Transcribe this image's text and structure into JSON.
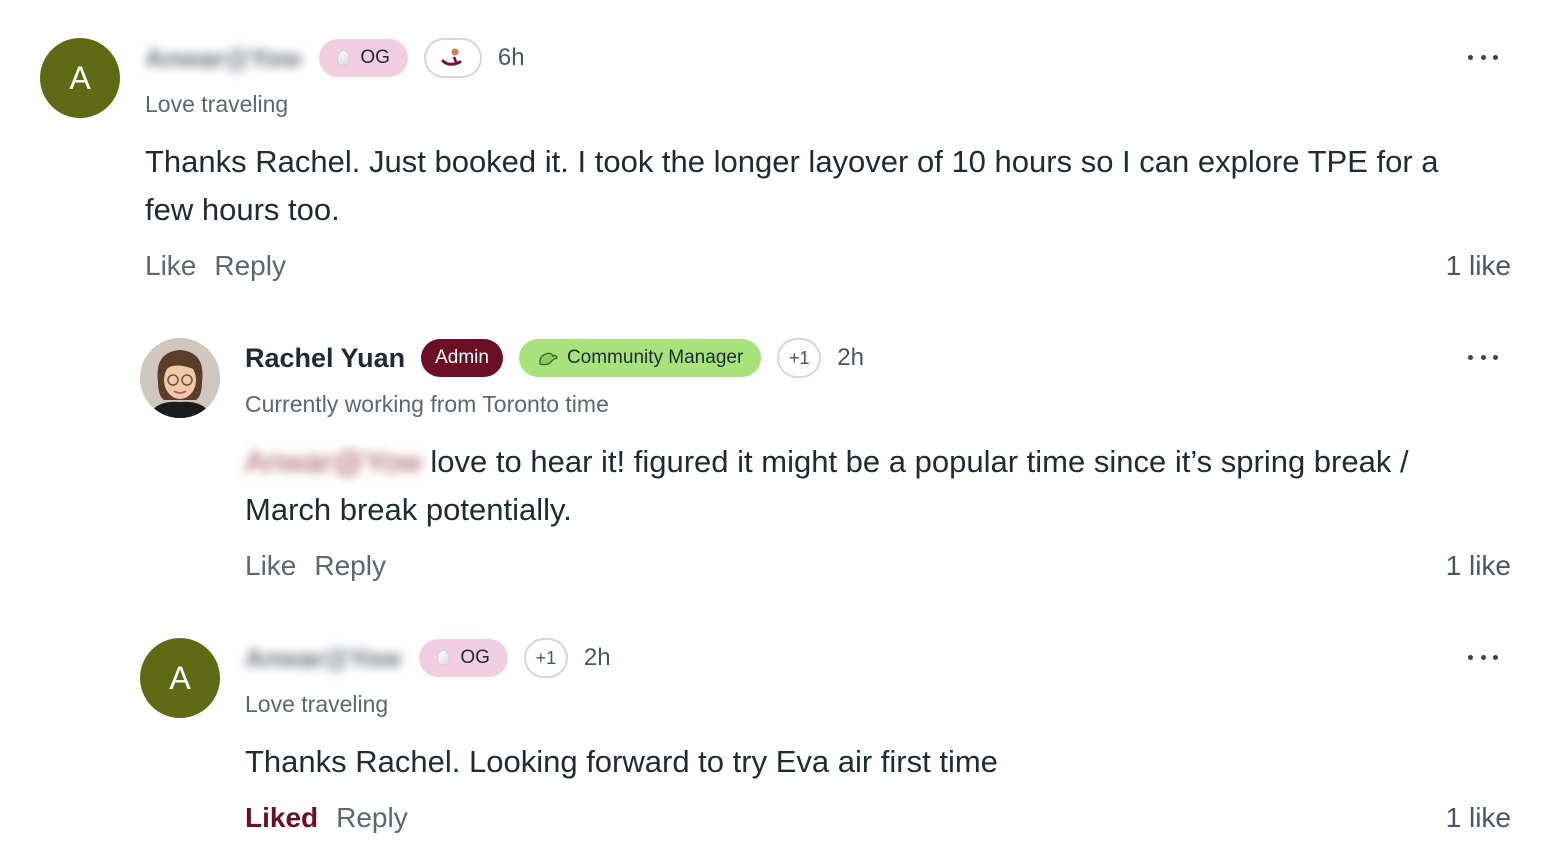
{
  "comments": [
    {
      "avatar_letter": "A",
      "author": "Anwar@Yow",
      "badges": {
        "og": "OG"
      },
      "time": "6h",
      "subtitle": "Love traveling",
      "body": "Thanks Rachel. Just booked it. I took the longer layover of 10 hours so I can explore TPE for a few hours too.",
      "like_label": "Like",
      "reply_label": "Reply",
      "like_count": "1 like"
    },
    {
      "author": "Rachel Yuan",
      "badges": {
        "admin": "Admin",
        "community_manager": "Community Manager",
        "plus": "+1"
      },
      "time": "2h",
      "subtitle": "Currently working from Toronto time",
      "mention": "Anwar@Yow",
      "body": "love to hear it! figured it might be a popular time since it’s spring break / March break potentially.",
      "like_label": "Like",
      "reply_label": "Reply",
      "like_count": "1 like"
    },
    {
      "avatar_letter": "A",
      "author": "Anwar@Yow",
      "badges": {
        "og": "OG",
        "plus": "+1"
      },
      "time": "2h",
      "subtitle": "Love traveling",
      "body": "Thanks Rachel. Looking forward to try Eva air first time",
      "like_label": "Liked",
      "reply_label": "Reply",
      "like_count": "1 like"
    }
  ],
  "colors": {
    "avatar": "#5e6b14",
    "admin": "#6c0f26",
    "community_manager": "#a8e27a",
    "og": "#f2cfe0",
    "liked": "#6c0f26"
  },
  "icons": [
    "ellipsis-icon",
    "egg-icon",
    "dragon-icon",
    "custom-badge-icon"
  ]
}
